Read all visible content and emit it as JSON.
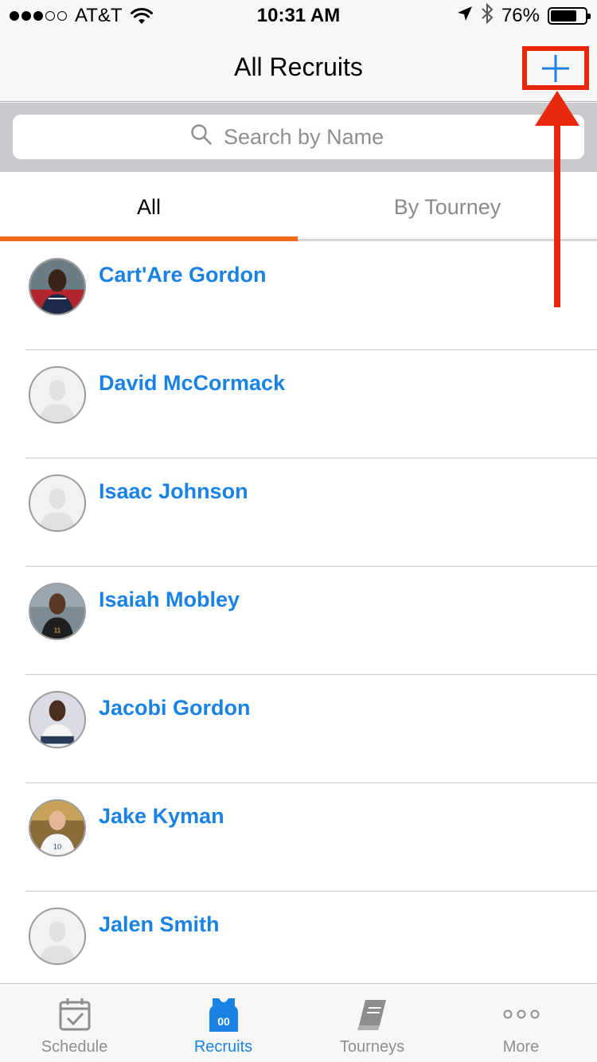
{
  "status_bar": {
    "carrier": "AT&T",
    "time": "10:31 AM",
    "battery_percent": "76%",
    "battery_level": 0.76,
    "signal_bars_filled": 3,
    "signal_bars_total": 5
  },
  "nav": {
    "title": "All Recruits",
    "add_button_icon": "plus-icon",
    "annotation_color": "#e8280c"
  },
  "search": {
    "placeholder": "Search by Name"
  },
  "tabs": {
    "all": "All",
    "by_tourney": "By Tourney",
    "active": "all",
    "accent": "#f26a1b"
  },
  "recruits": [
    {
      "name": "Cart'Are Gordon",
      "photo": "player-photo"
    },
    {
      "name": "David McCormack",
      "photo": "placeholder"
    },
    {
      "name": "Isaac Johnson",
      "photo": "placeholder"
    },
    {
      "name": "Isaiah Mobley",
      "photo": "player-photo"
    },
    {
      "name": "Jacobi Gordon",
      "photo": "player-photo"
    },
    {
      "name": "Jake Kyman",
      "photo": "player-photo"
    },
    {
      "name": "Jalen Smith",
      "photo": "placeholder"
    }
  ],
  "tab_bar": {
    "schedule": "Schedule",
    "recruits": "Recruits",
    "recruits_jersey_number": "00",
    "tourneys": "Tourneys",
    "more": "More",
    "active": "recruits",
    "link_color": "#1a82e2"
  }
}
